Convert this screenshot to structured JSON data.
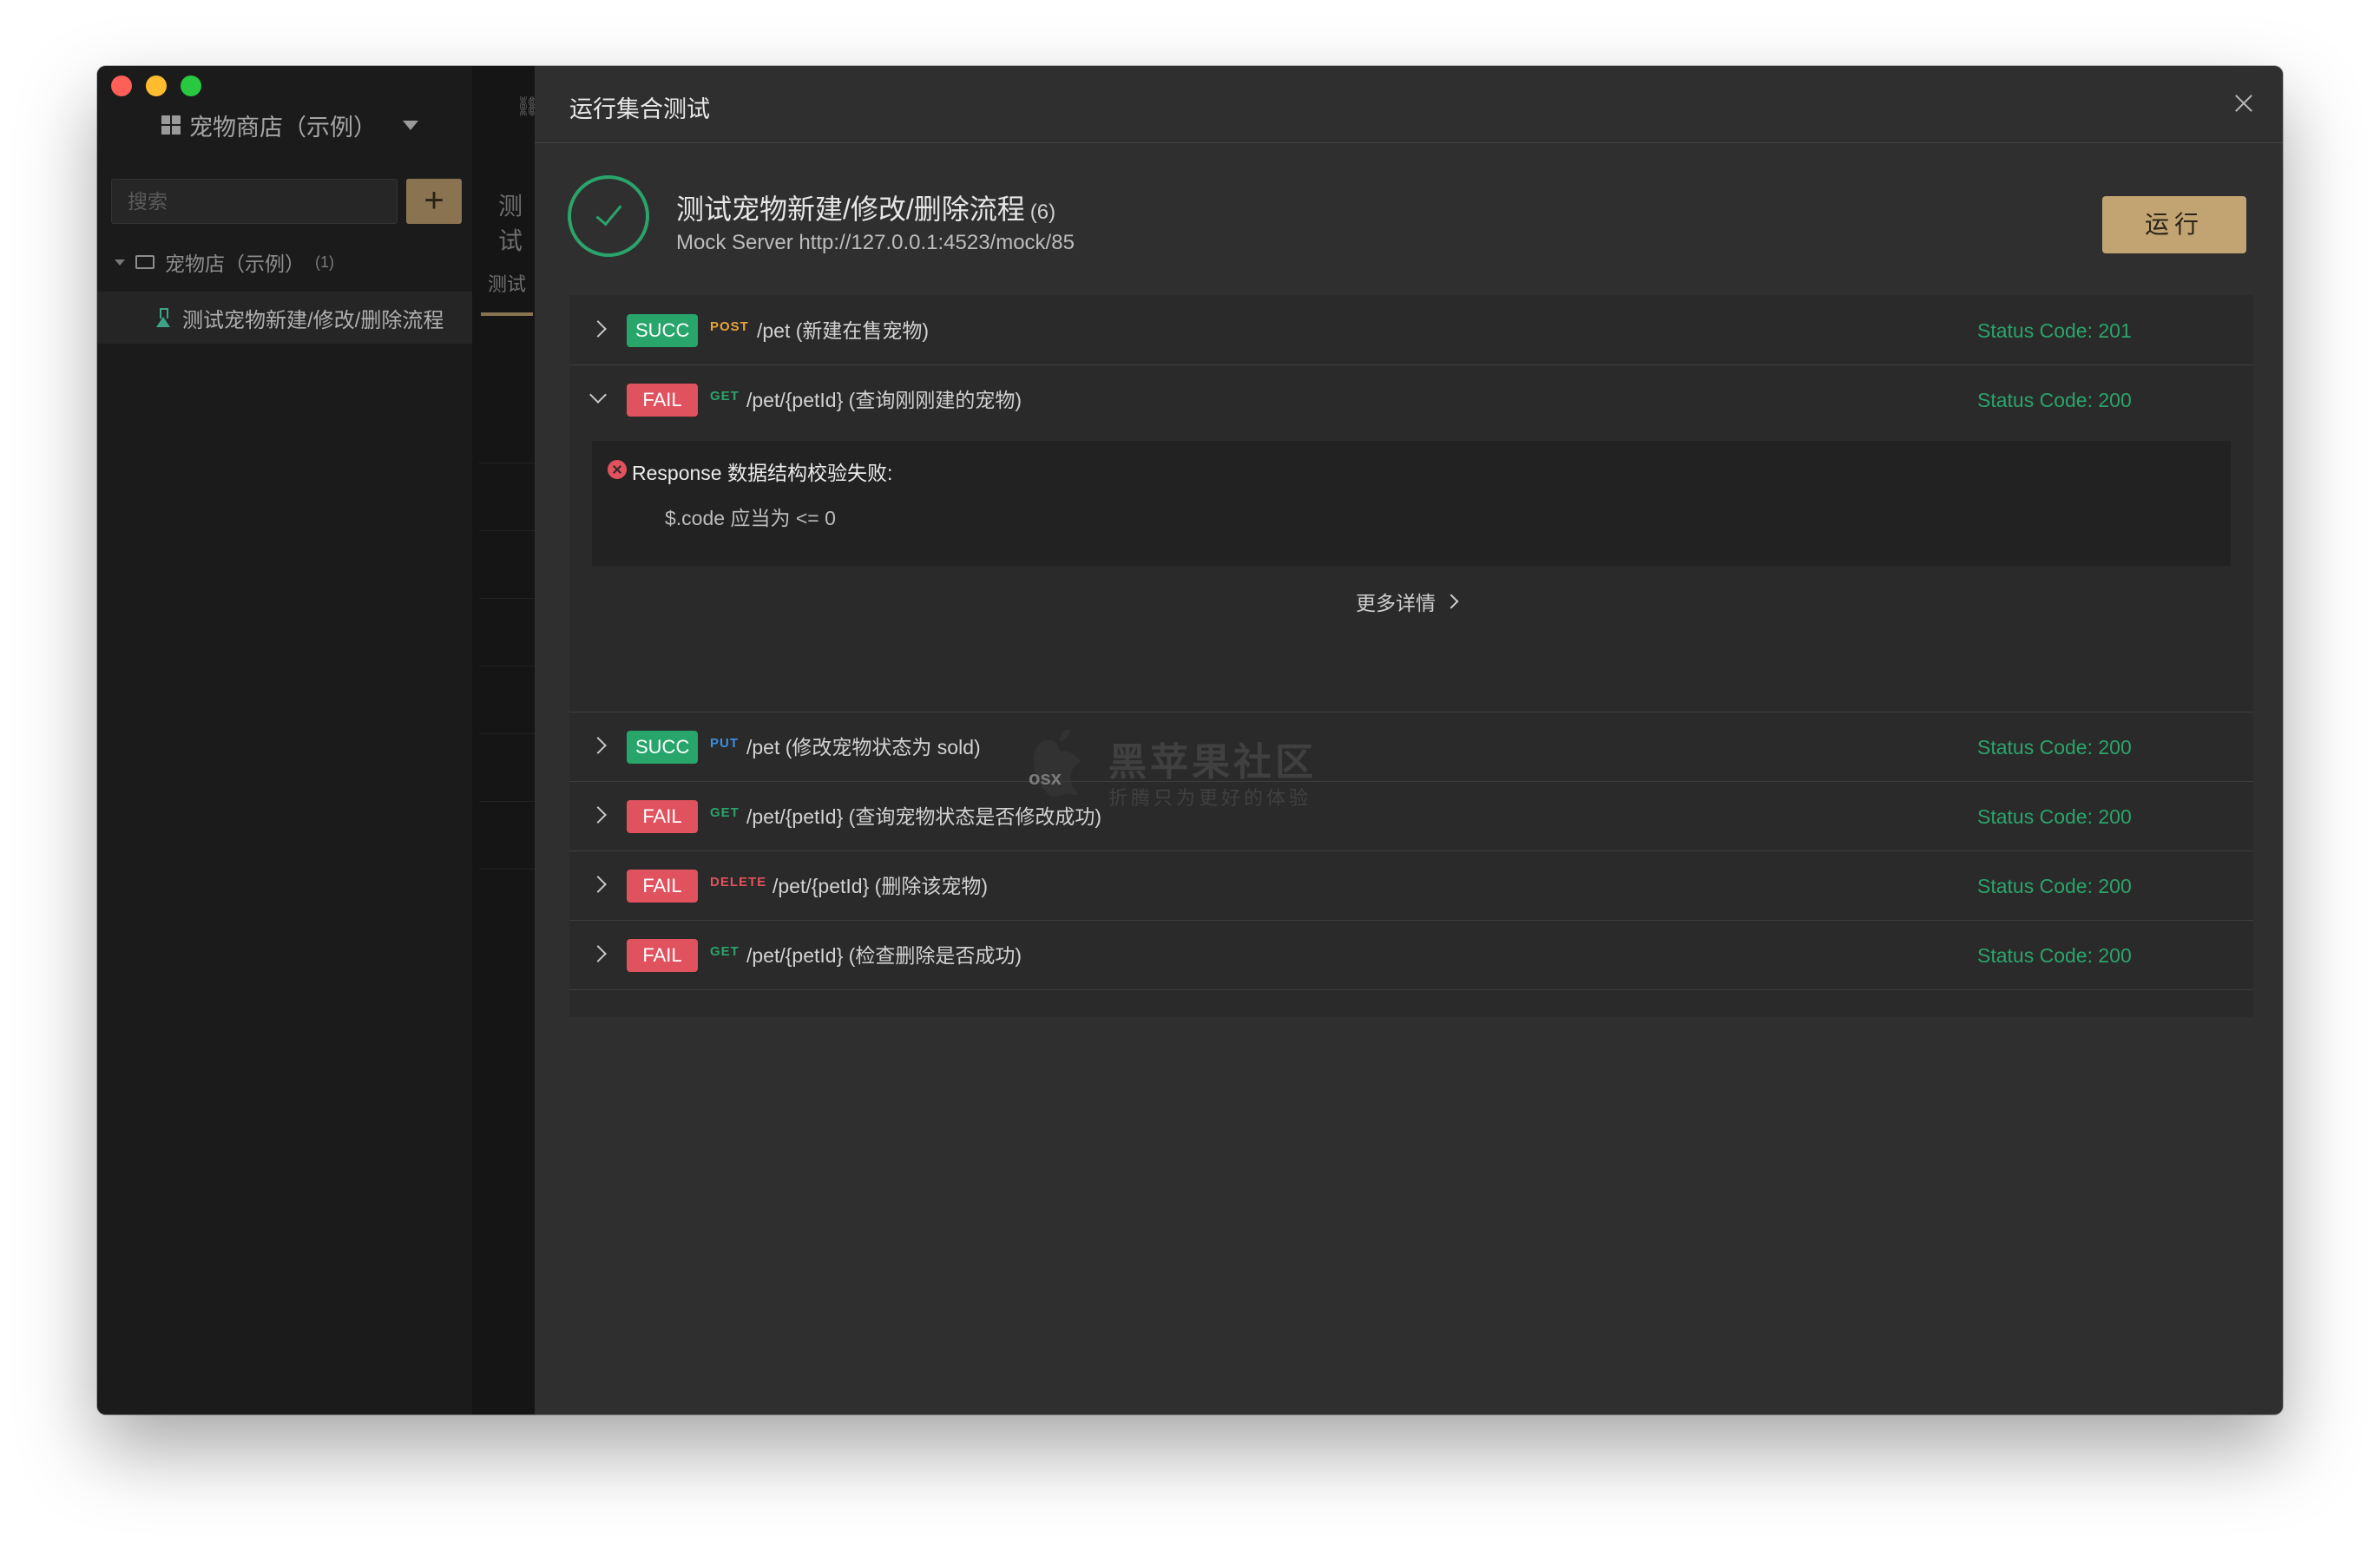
{
  "sidebar": {
    "project_name": "宠物商店（示例）",
    "search_placeholder": "搜索",
    "add_label": "+",
    "folder_name": "宠物店（示例）",
    "folder_count": "(1)",
    "item_label": "测试宠物新建/修改/删除流程"
  },
  "middle": {
    "title": "测试",
    "tab": "测试"
  },
  "modal": {
    "title": "运行集合测试",
    "collection_name": "测试宠物新建/修改/删除流程",
    "collection_count": "(6)",
    "mock_server": "Mock Server http://127.0.0.1:4523/mock/85",
    "run_label": "运行",
    "results": [
      {
        "status": "SUCC",
        "method": "POST",
        "method_color": "#e8a33a",
        "path": "/pet (新建在售宠物)",
        "code": "Status Code: 201"
      },
      {
        "status": "FAIL",
        "method": "GET",
        "method_color": "#2ba46b",
        "path": "/pet/{petId} (查询刚刚建的宠物)",
        "code": "Status Code: 200"
      },
      {
        "status": "SUCC",
        "method": "PUT",
        "method_color": "#3a8fe0",
        "path": "/pet (修改宠物状态为 sold)",
        "code": "Status Code: 200"
      },
      {
        "status": "FAIL",
        "method": "GET",
        "method_color": "#2ba46b",
        "path": "/pet/{petId} (查询宠物状态是否修改成功)",
        "code": "Status Code: 200"
      },
      {
        "status": "FAIL",
        "method": "DELETE",
        "method_color": "#e0525d",
        "path": "/pet/{petId} (删除该宠物)",
        "code": "Status Code: 200"
      },
      {
        "status": "FAIL",
        "method": "GET",
        "method_color": "#2ba46b",
        "path": "/pet/{petId} (检查删除是否成功)",
        "code": "Status Code: 200"
      }
    ],
    "error_title": "Response 数据结构校验失败:",
    "error_detail": "$.code 应当为 <= 0",
    "more_label": "更多详情"
  },
  "watermark": {
    "logo_text": "osx",
    "main": "黑苹果社区",
    "sub": "折腾只为更好的体验"
  }
}
